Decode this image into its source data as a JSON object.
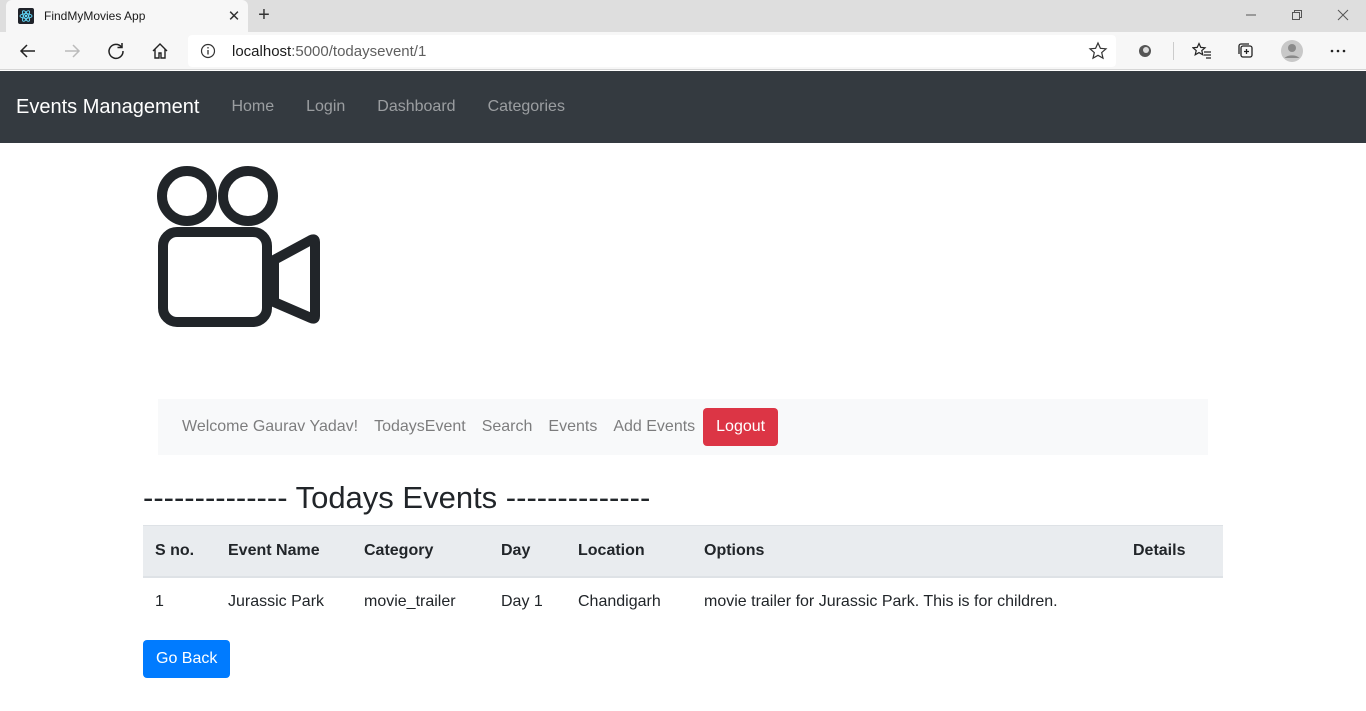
{
  "browser": {
    "tab_title": "FindMyMovies App",
    "url_host": "localhost",
    "url_path": ":5000/todaysevent/1"
  },
  "navbar": {
    "brand": "Events Management",
    "links": [
      "Home",
      "Login",
      "Dashboard",
      "Categories"
    ]
  },
  "subnav": {
    "welcome": "Welcome Gaurav Yadav!",
    "links": [
      "TodaysEvent",
      "Search",
      "Events",
      "Add Events"
    ],
    "logout_label": "Logout"
  },
  "page": {
    "heading": "-------------- Todays Events --------------"
  },
  "table": {
    "headers": [
      "S no.",
      "Event Name",
      "Category",
      "Day",
      "Location",
      "Options",
      "Details"
    ],
    "rows": [
      [
        "1",
        "Jurassic Park",
        "movie_trailer",
        "Day 1",
        "Chandigarh",
        "movie trailer for Jurassic Park. This is for children.",
        ""
      ]
    ]
  },
  "actions": {
    "back_label": "Go Back"
  },
  "colors": {
    "navbar_bg": "#343a40",
    "logout_bg": "#dc3545",
    "back_bg": "#007bff"
  }
}
